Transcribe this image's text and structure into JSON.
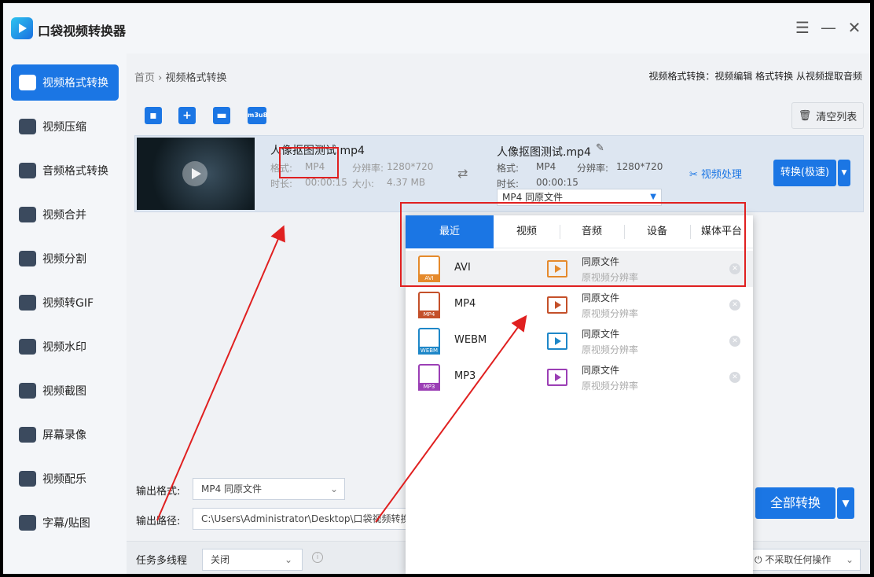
{
  "app": {
    "title": "口袋视频转换器",
    "win_buttons": [
      "☰",
      "—",
      "✕"
    ]
  },
  "sidebar": {
    "items": [
      {
        "label": "视频格式转换",
        "active": true
      },
      {
        "label": "视频压缩"
      },
      {
        "label": "音频格式转换"
      },
      {
        "label": "视频合并"
      },
      {
        "label": "视频分割"
      },
      {
        "label": "视频转GIF"
      },
      {
        "label": "视频水印"
      },
      {
        "label": "视频截图"
      },
      {
        "label": "屏幕录像"
      },
      {
        "label": "视频配乐"
      },
      {
        "label": "字幕/贴图"
      }
    ]
  },
  "breadcrumb": {
    "home": "首页",
    "sep": "›",
    "current": "视频格式转换"
  },
  "top_links": "视频格式转换：视频编辑 格式转换 从视频提取音频",
  "toolbar": {
    "m3u8": "m3u8",
    "clear_label": "清空列表"
  },
  "file": {
    "name": "人像抠图测试.mp4",
    "format_label": "格式:",
    "format": "MP4",
    "res_label": "分辨率:",
    "res": "1280*720",
    "dur_label": "时长:",
    "dur": "00:00:15",
    "size_label": "大小:",
    "size": "4.37 MB",
    "out_name": "人像抠图测试.mp4",
    "out_format_label": "格式:",
    "out_format": "MP4",
    "out_res_label": "分辨率:",
    "out_res": "1280*720",
    "out_dur_label": "时长:",
    "out_dur": "00:00:15",
    "out_select": "MP4  同原文件",
    "process_label": "视频处理",
    "convert_label": "转换(极速)"
  },
  "bottom": {
    "format_label": "输出格式:",
    "format_value": "MP4  同原文件",
    "path_label": "输出路径:",
    "path_value": "C:\\Users\\Administrator\\Desktop\\口袋视频转换",
    "thread_label": "任务多线程",
    "thread_value": "关闭",
    "convert_all": "全部转换",
    "after_action": "不采取任何操作"
  },
  "popup": {
    "tabs": [
      "最近",
      "视频",
      "音频",
      "设备",
      "媒体平台"
    ],
    "rows": [
      {
        "fmt": "AVI",
        "color": "#e58a2c",
        "title": "同原文件",
        "sub": "原视频分辨率",
        "highlight": true
      },
      {
        "fmt": "MP4",
        "color": "#c4502a",
        "title": "同原文件",
        "sub": "原视频分辨率"
      },
      {
        "fmt": "WEBM",
        "color": "#1e87c8",
        "title": "同原文件",
        "sub": "原视频分辨率"
      },
      {
        "fmt": "MP3",
        "color": "#9b3fb5",
        "title": "同原文件",
        "sub": "原视频分辨率"
      }
    ]
  },
  "colors": {
    "accent": "#1b76e4",
    "annotation": "#e02020"
  }
}
